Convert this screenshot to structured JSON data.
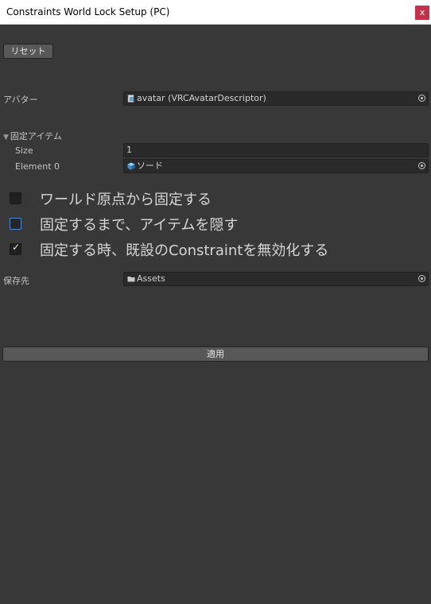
{
  "window": {
    "title": "Constraints World Lock Setup (PC)",
    "close_glyph": "x"
  },
  "reset_button": "リセット",
  "avatar": {
    "label": "アバター",
    "value": "avatar (VRCAvatarDescriptor)",
    "icon": "avatar-descriptor-icon"
  },
  "fixed_items": {
    "label": "固定アイテム",
    "expanded": true,
    "size_label": "Size",
    "size_value": "1",
    "element0_label": "Element 0",
    "element0_value": "ソード",
    "element0_icon": "prefab-cube-icon"
  },
  "options": [
    {
      "label": "ワールド原点から固定する",
      "checked": false
    },
    {
      "label": "固定するまで、アイテムを隠す",
      "checked": false
    },
    {
      "label": "固定する時、既設のConstraintを無効化する",
      "checked": true
    }
  ],
  "save_to": {
    "label": "保存先",
    "value": "Assets",
    "icon": "folder-icon"
  },
  "apply_button": "適用",
  "colors": {
    "background": "#383838",
    "field_background": "#2a2a2a",
    "button_background": "#585858",
    "close_button": "#c4314b",
    "focus_outline": "#4d8bd8",
    "prefab_icon": "#4aa3df"
  }
}
